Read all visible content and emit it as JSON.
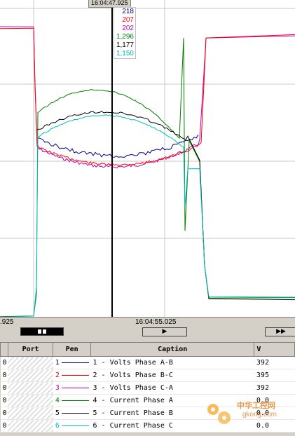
{
  "cursor": {
    "time_top": "16:04:47.925",
    "readouts": [
      {
        "value": "218",
        "color": "#000080"
      },
      {
        "value": "207",
        "color": "#ff0000"
      },
      {
        "value": "202",
        "color": "#c000c0"
      },
      {
        "value": "1,296",
        "color": "#008000"
      },
      {
        "value": "1,177",
        "color": "#000000"
      },
      {
        "value": "1,150",
        "color": "#00c0c0"
      }
    ]
  },
  "timebar": {
    "left_label": ".925",
    "center_label": "16:04:55.025",
    "play_glyph": "▶",
    "ff_glyph": "▶▶"
  },
  "table": {
    "headers": {
      "port": "Port",
      "pen": "Pen",
      "caption": "Caption",
      "value": "V"
    },
    "rows": [
      {
        "first": "0",
        "pen": "1",
        "caption": "1 - Volts Phase A-B",
        "value": "392",
        "color": "#000080"
      },
      {
        "first": "0",
        "pen": "2",
        "caption": "2 - Volts Phase B-C",
        "value": "395",
        "color": "#ff0000"
      },
      {
        "first": "0",
        "pen": "3",
        "caption": "3 - Volts Phase C-A",
        "value": "392",
        "color": "#c000c0"
      },
      {
        "first": "0",
        "pen": "4",
        "caption": "4 - Current Phase A",
        "value": "0.0",
        "color": "#008000"
      },
      {
        "first": "0",
        "pen": "5",
        "caption": "5 - Current Phase B",
        "value": "0.0",
        "color": "#000000"
      },
      {
        "first": "0",
        "pen": "6",
        "caption": "6 - Current Phase C",
        "value": "0.0",
        "color": "#00c0c0"
      }
    ]
  },
  "watermark": {
    "line1": "中华工控网",
    "line2": "gkong.com"
  }
}
